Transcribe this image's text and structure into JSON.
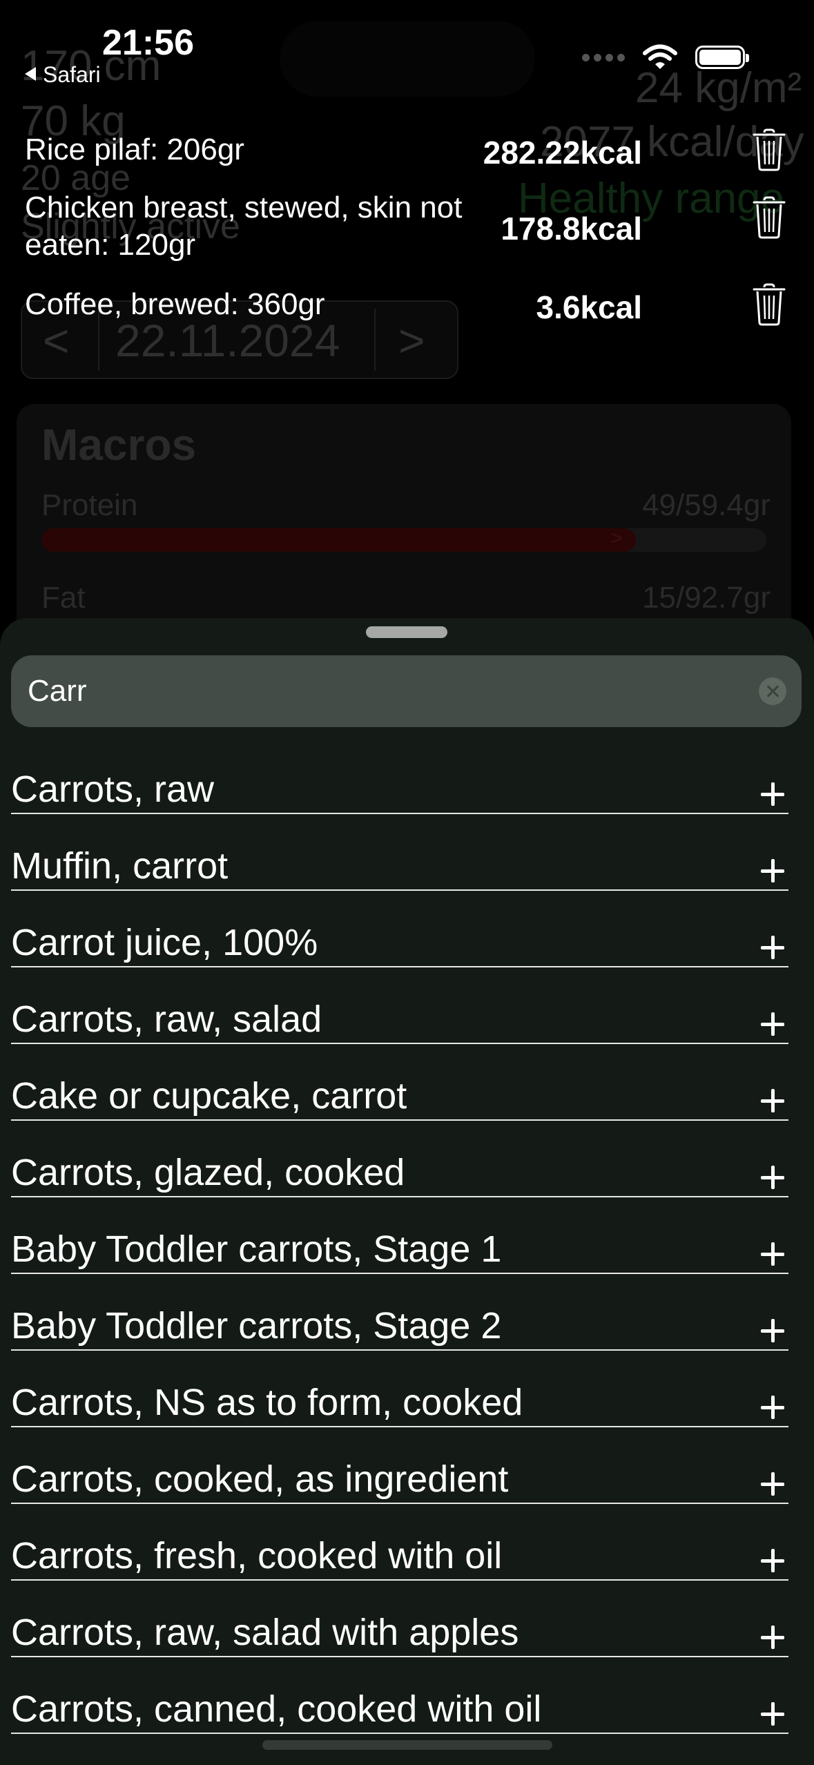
{
  "status_bar": {
    "time": "21:56",
    "back_label": "Safari"
  },
  "background": {
    "height": "170 cm",
    "weight": "70 kg",
    "age": "20 age",
    "activity": "Slightly active",
    "bmi": "24 kg/m²",
    "calories": "2077 kcal/day",
    "bmi_status": "Healthy range",
    "date_prev": "<",
    "date": "22.11.2024",
    "date_next": ">",
    "macros_title": "Macros",
    "protein_label": "Protein",
    "protein_value": "49/59.4gr",
    "protein_arrow": ">",
    "protein_fill": 0.82,
    "fat_label": "Fat",
    "fat_value": "15/92.7gr"
  },
  "entries": [
    {
      "name": "Rice pilaf:  206gr",
      "kcal": "282.22kcal"
    },
    {
      "name": "Chicken breast, stewed, skin not eaten:  120gr",
      "kcal": "178.8kcal"
    },
    {
      "name": "Coffee, brewed:  360gr",
      "kcal": "3.6kcal"
    }
  ],
  "search": {
    "value": "Carr"
  },
  "results": [
    "Carrots, raw",
    "Muffin, carrot",
    "Carrot juice, 100%",
    "Carrots, raw, salad",
    "Cake or cupcake, carrot",
    "Carrots, glazed, cooked",
    "Baby Toddler carrots, Stage 1",
    "Baby Toddler carrots, Stage 2",
    "Carrots, NS as to form, cooked",
    "Carrots, cooked, as ingredient",
    "Carrots, fresh, cooked with oil",
    "Carrots, raw, salad with apples",
    "Carrots, canned, cooked with oil"
  ],
  "icons": {
    "delete": "trash-icon",
    "add": "plus-icon",
    "clear": "clear-icon",
    "wifi": "wifi-icon",
    "battery": "battery-icon"
  }
}
